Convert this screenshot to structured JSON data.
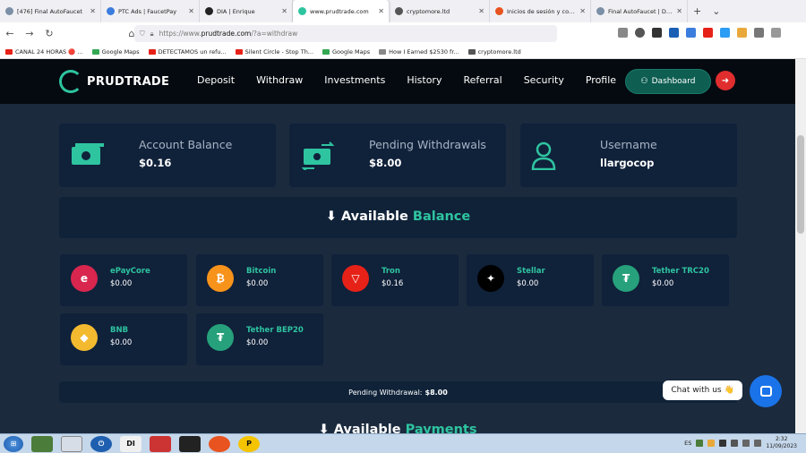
{
  "browser": {
    "tabs": [
      {
        "label": "[476] Final AutoFaucet",
        "favicon_color": "#7b8fa6",
        "active": false
      },
      {
        "label": "PTC Ads | FaucetPay",
        "favicon_color": "#3b7ddd",
        "active": false
      },
      {
        "label": "DIA | Enrique",
        "favicon_color": "#222222",
        "active": false
      },
      {
        "label": "www.prudtrade.com",
        "favicon_color": "#2ec4a0",
        "active": true
      },
      {
        "label": "cryptomore.ltd",
        "favicon_color": "#555555",
        "active": false
      },
      {
        "label": "Inicios de sesión y contr",
        "favicon_color": "#e8531f",
        "active": false
      },
      {
        "label": "Final AutoFaucet | Dutch",
        "favicon_color": "#7b8fa6",
        "active": false
      }
    ],
    "new_tab": "+",
    "url_prefix": "https://www.",
    "url_domain": "prudtrade.com",
    "url_suffix": "/?a=withdraw",
    "bookmarks": [
      {
        "label": "CANAL 24 HORAS 🔴 ...",
        "color": "#e62117"
      },
      {
        "label": "Google Maps",
        "color": "#34a853"
      },
      {
        "label": "DETECTAMOS un refu...",
        "color": "#e62117"
      },
      {
        "label": "Silent Circle - Stop Th...",
        "color": "#e62117"
      },
      {
        "label": "Google Maps",
        "color": "#34a853"
      },
      {
        "label": "How I Earned $2530 fr...",
        "color": "#888888"
      },
      {
        "label": "cryptomore.ltd",
        "color": "#555555"
      }
    ]
  },
  "site": {
    "brand": "PRUDTRADE",
    "menu": [
      "Deposit",
      "Withdraw",
      "Investments",
      "History",
      "Referral",
      "Security",
      "Profile"
    ],
    "dashboard_label": "Dashboard",
    "accent": "#2ec4a0"
  },
  "stats": [
    {
      "title": "Account Balance",
      "value": "$0.16",
      "icon": "money-icon"
    },
    {
      "title": "Pending Withdrawals",
      "value": "$8.00",
      "icon": "exchange-money-icon"
    },
    {
      "title": "Username",
      "value": "llargocop",
      "icon": "user-icon"
    }
  ],
  "available": {
    "prefix": "Available",
    "highlight": "Balance"
  },
  "coins": [
    {
      "name": "ePayCore",
      "value": "$0.00",
      "color": "#d8264f",
      "glyph": "e"
    },
    {
      "name": "Bitcoin",
      "value": "$0.00",
      "color": "#f7931a",
      "glyph": "₿"
    },
    {
      "name": "Tron",
      "value": "$0.16",
      "color": "#e62117",
      "glyph": "▽"
    },
    {
      "name": "Stellar",
      "value": "$0.00",
      "color": "#000000",
      "glyph": "✦"
    },
    {
      "name": "Tether TRC20",
      "value": "$0.00",
      "color": "#26a17b",
      "glyph": "₮"
    },
    {
      "name": "BNB",
      "value": "$0.00",
      "color": "#f3ba2f",
      "glyph": "◆"
    },
    {
      "name": "Tether BEP20",
      "value": "$0.00",
      "color": "#26a17b",
      "glyph": "₮"
    }
  ],
  "pending": {
    "label": "Pending Withdrawal:",
    "value": "$8.00"
  },
  "payments": {
    "prefix": "Available",
    "highlight": "Payments"
  },
  "chat": {
    "label": "Chat with us 👋"
  },
  "taskbar": {
    "lang": "ES",
    "time": "2:32",
    "date": "11/09/2023"
  }
}
